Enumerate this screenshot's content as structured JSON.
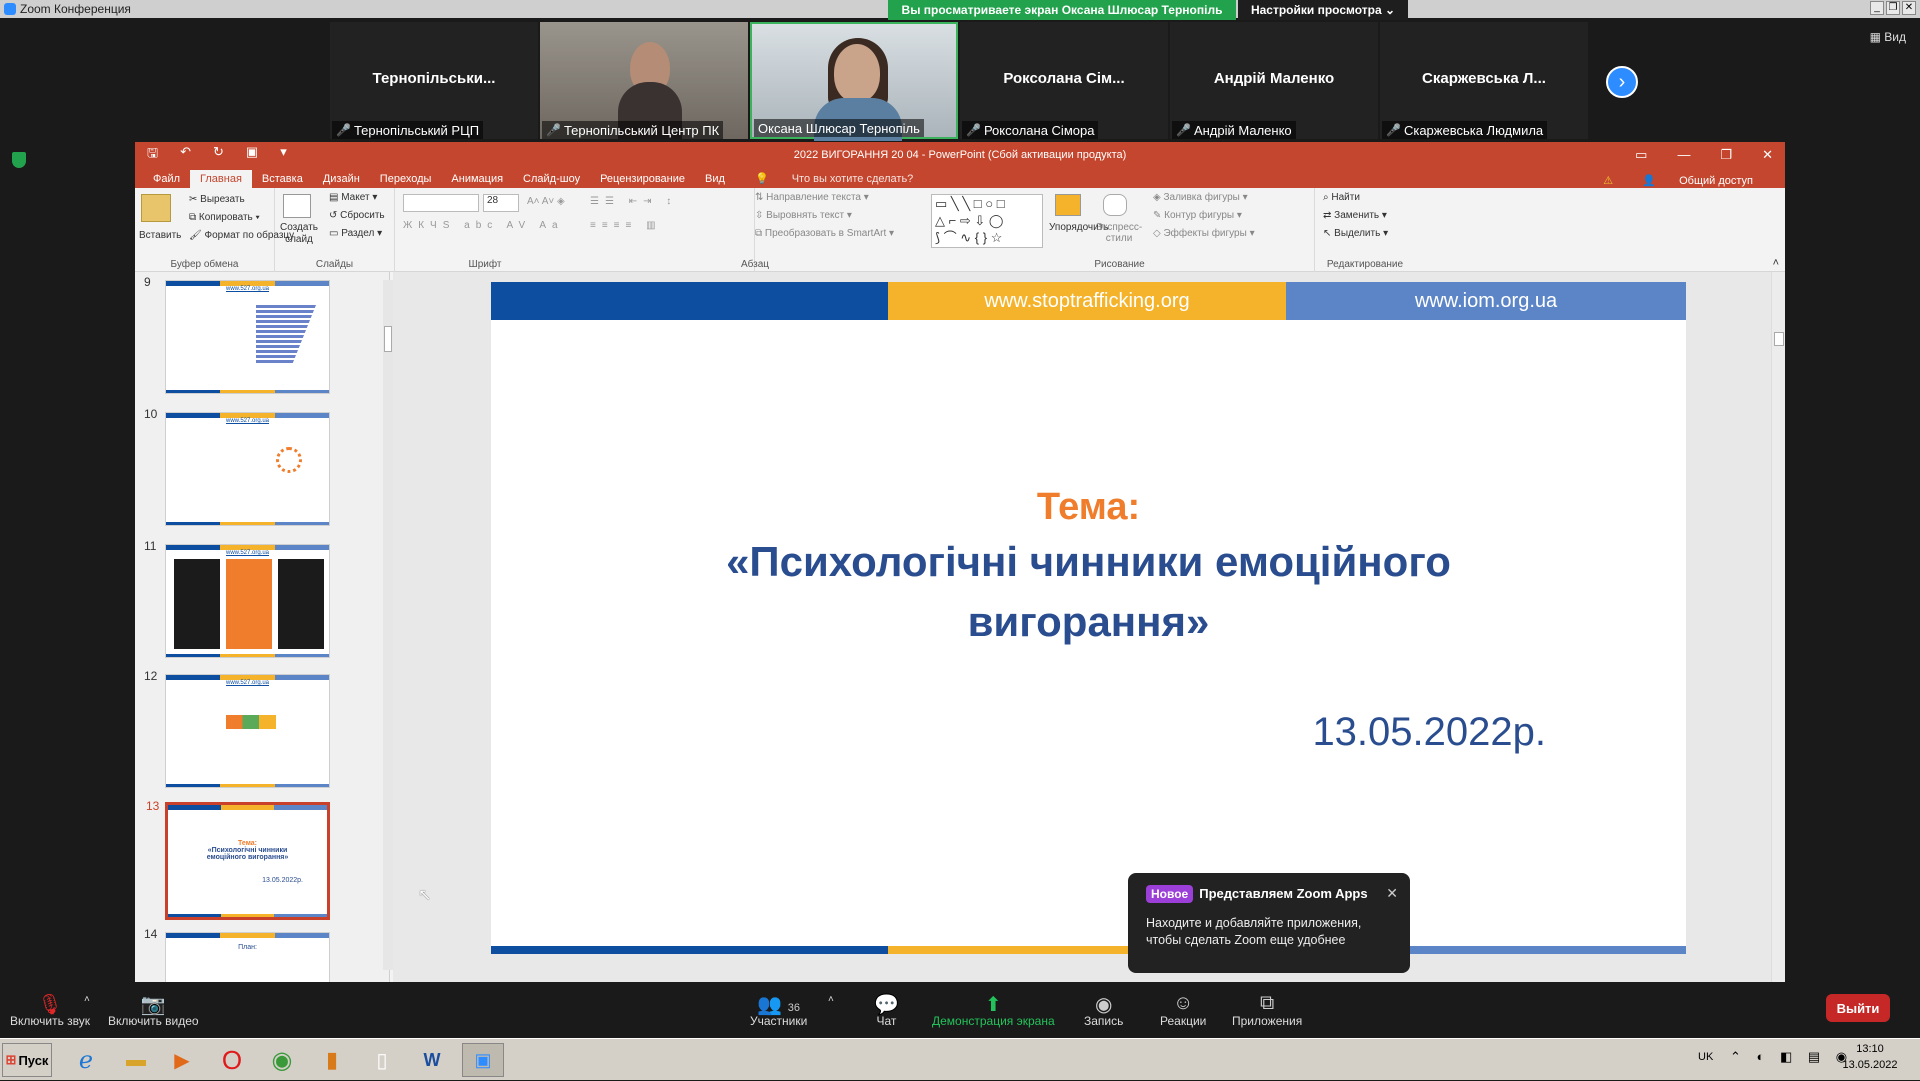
{
  "zoom": {
    "window_title": "Zoom Конференция",
    "share_banner": "Вы просматриваете экран Оксана Шлюсар Тернопіль",
    "view_settings": "Настройки просмотра ⌄",
    "view_toggle": "▦ Вид",
    "participants": [
      {
        "big": "Тернопільськи...",
        "label": "Тернопільський РЦП",
        "video": false
      },
      {
        "big": "",
        "label": "Тернопільський Центр ПК",
        "video": true
      },
      {
        "big": "",
        "label": "Оксана Шлюсар Тернопіль",
        "video": true
      },
      {
        "big": "Роксолана Сім...",
        "label": "Роксолана Сімора",
        "video": false
      },
      {
        "big": "Андрій Маленко",
        "label": "Андрій Маленко",
        "video": false
      },
      {
        "big": "Скаржевська Л...",
        "label": "Скаржевська Людмила",
        "video": false
      }
    ],
    "toolbar": {
      "audio": "Включить звук",
      "video": "Включить видео",
      "participants": "Участники",
      "participants_count": "36",
      "chat": "Чат",
      "share": "Демонстрация экрана",
      "record": "Запись",
      "reactions": "Реакции",
      "apps": "Приложения",
      "leave": "Выйти"
    },
    "popup": {
      "badge": "Новое",
      "title": "Представляем Zoom Apps",
      "text": "Находите и добавляйте приложения, чтобы сделать Zoom еще удобнее"
    }
  },
  "ppt": {
    "title": "2022 ВИГОРАННЯ 20 04 - PowerPoint (Сбой активации продукта)",
    "tabs": [
      "Файл",
      "Главная",
      "Вставка",
      "Дизайн",
      "Переходы",
      "Анимация",
      "Слайд-шоу",
      "Рецензирование",
      "Вид"
    ],
    "tell_me": "Что вы хотите сделать?",
    "share": "Общий доступ",
    "ribbon": {
      "paste": "Вставить",
      "cut": "Вырезать",
      "copy": "Копировать",
      "format_painter": "Формат по образцу",
      "clipboard": "Буфер обмена",
      "new_slide": "Создать слайд",
      "layout": "Макет",
      "reset": "Сбросить",
      "section": "Раздел",
      "slides": "Слайды",
      "font_size": "28",
      "font": "Шрифт",
      "text_dir": "Направление текста",
      "align_text": "Выровнять текст",
      "smartart": "Преобразовать в SmartArt",
      "paragraph": "Абзац",
      "arrange": "Упорядочить",
      "quick_styles": "Экспресс-стили",
      "shape_fill": "Заливка фигуры",
      "shape_outline": "Контур фигуры",
      "shape_effects": "Эффекты фигуры",
      "drawing": "Рисование",
      "find": "Найти",
      "replace": "Заменить",
      "select": "Выделить",
      "editing": "Редактирование"
    },
    "thumbs": [
      {
        "num": "9",
        "url": "www.527.org.ua",
        "selected": false
      },
      {
        "num": "10",
        "url": "www.527.org.ua",
        "selected": false
      },
      {
        "num": "11",
        "url": "www.527.org.ua",
        "selected": false
      },
      {
        "num": "12",
        "url": "www.527.org.ua",
        "selected": false
      },
      {
        "num": "13",
        "url": "",
        "selected": true
      },
      {
        "num": "14",
        "url": "",
        "selected": false
      }
    ],
    "thumb13": {
      "tema": "Тема:",
      "title": "«Психологічні чинники емоційного вигорання»",
      "date": "13.05.2022р."
    },
    "thumb14_title": "План:",
    "slide": {
      "url_left": "www.stoptrafficking.org",
      "url_right": "www.iom.org.ua",
      "tema": "Тема:",
      "title_line1": "«Психологічні чинники емоційного",
      "title_line2": "вигорання»",
      "date": "13.05.2022р."
    }
  },
  "taskbar": {
    "start": "Пуск",
    "lang": "UK",
    "time": "13:10",
    "date": "13.05.2022"
  },
  "colors": {
    "ppt_red": "#c4462e",
    "iom_blue": "#0d4ea0",
    "iom_yellow": "#f4b32b",
    "iom_lightblue": "#5b85c6",
    "title_blue": "#2a4d8f",
    "tema_orange": "#ef7d2b",
    "zoom_green": "#23a24d",
    "zoom_blue": "#2d8cff"
  }
}
